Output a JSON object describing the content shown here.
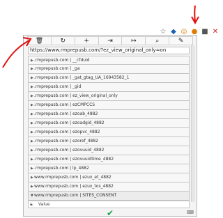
{
  "chrome": {
    "icons": [
      {
        "name": "star-icon",
        "glyph": "☆"
      },
      {
        "name": "shield-icon",
        "glyph": "◆"
      },
      {
        "name": "cookie-extension-icon",
        "glyph": "◎"
      },
      {
        "name": "orange-extension-icon",
        "glyph": "●"
      },
      {
        "name": "security-icon",
        "glyph": "■"
      },
      {
        "name": "pdf-icon",
        "glyph": "✕"
      }
    ]
  },
  "toolbar": {
    "buttons": [
      {
        "name": "delete-icon",
        "glyph": "🗑"
      },
      {
        "name": "refresh-icon",
        "glyph": "↻"
      },
      {
        "name": "add-icon",
        "glyph": "+"
      },
      {
        "name": "import-icon",
        "glyph": "⇥"
      },
      {
        "name": "export-icon",
        "glyph": "↦"
      },
      {
        "name": "search-icon",
        "glyph": "⌕"
      },
      {
        "name": "settings-icon",
        "glyph": "✎"
      }
    ]
  },
  "url": "https://www.rmprepusb.com/?ez_view_original_only=on",
  "cookies": [
    ".rmprepusb.com | __cfduid",
    ".rmprepusb.com | _ga",
    ".rmprepusb.com | _gat_gtag_UA_16943582_1",
    ".rmprepusb.com | _gid",
    ".rmprepusb.com | ez_view_original_only",
    ".rmprepusb.com | ezCMPCCS",
    ".rmprepusb.com | ezoab_4882",
    ".rmprepusb.com | ezoadgid_4882",
    ".rmprepusb.com | ezopvc_4882",
    ".rmprepusb.com | ezoref_4882",
    ".rmprepusb.com | ezovuuid_4882",
    ".rmprepusb.com | ezovuuidtime_4882",
    ".rmprepusb.com | lp_4882",
    "www.rmprepusb.com | ezux_et_4882",
    "www.rmprepusb.com | ezux_tos_4882",
    "www.rmprepusb.com | SITES_CONSENT"
  ],
  "value_label": "Value",
  "confirm_glyph": "✔",
  "keyboard_glyph": "⌨"
}
